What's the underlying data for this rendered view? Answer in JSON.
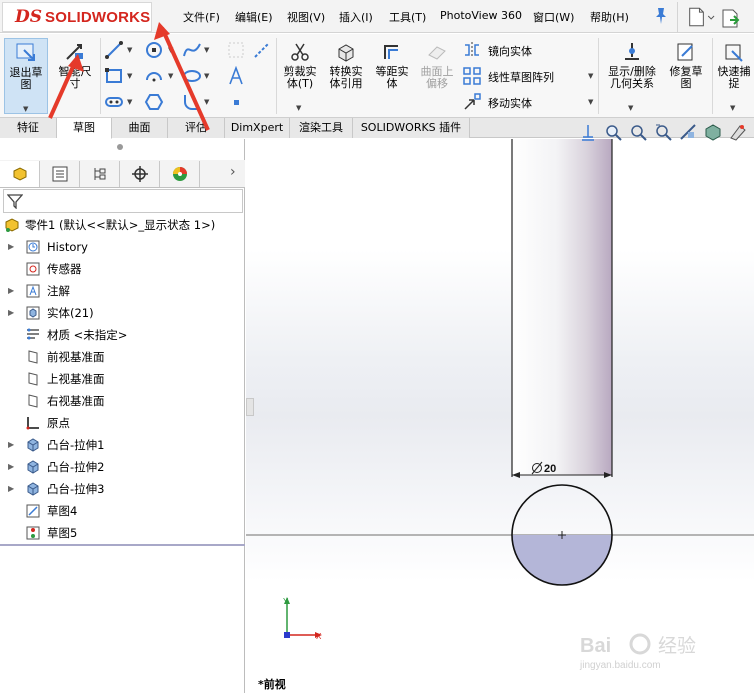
{
  "app": {
    "logo_prefix": "DS",
    "logo_text": "SOLIDWORKS"
  },
  "menubar": {
    "items": [
      {
        "label": "文件(F)"
      },
      {
        "label": "编辑(E)"
      },
      {
        "label": "视图(V)"
      },
      {
        "label": "插入(I)"
      },
      {
        "label": "工具(T)"
      },
      {
        "label": "PhotoView 360"
      },
      {
        "label": "窗口(W)"
      },
      {
        "label": "帮助(H)"
      }
    ]
  },
  "ribbon": {
    "exit_sketch": "退出草\n图",
    "smart_dimension": "智能尺\n寸",
    "trim": "剪裁实\n体(T)",
    "convert": "转换实\n体引用",
    "offset": "等距实\n体",
    "offset_surface": "曲面上\n偏移",
    "mirror": "镜向实体",
    "linear_pattern": "线性草图阵列",
    "move": "移动实体",
    "display_relations": "显示/删除\n几何关系",
    "repair": "修复草\n图",
    "quick_snap": "快速捕\n捉"
  },
  "tabs": [
    {
      "label": "特征"
    },
    {
      "label": "草图"
    },
    {
      "label": "曲面"
    },
    {
      "label": "评估"
    },
    {
      "label": "DimXpert"
    },
    {
      "label": "渲染工具"
    },
    {
      "label": "SOLIDWORKS 插件"
    }
  ],
  "tree": {
    "root": "零件1  (默认<<默认>_显示状态 1>)",
    "items": [
      {
        "label": "History"
      },
      {
        "label": "传感器"
      },
      {
        "label": "注解"
      },
      {
        "label": "实体(21)"
      },
      {
        "label": "材质 <未指定>"
      },
      {
        "label": "前视基准面"
      },
      {
        "label": "上视基准面"
      },
      {
        "label": "右视基准面"
      },
      {
        "label": "原点"
      },
      {
        "label": "凸台-拉伸1"
      },
      {
        "label": "凸台-拉伸2"
      },
      {
        "label": "凸台-拉伸3"
      },
      {
        "label": "草图4"
      },
      {
        "label": "草图5"
      }
    ]
  },
  "viewport": {
    "dimension": "20",
    "view_name": "*前视",
    "axis_x": "X",
    "axis_y": "Y",
    "watermark_brand": "Bai",
    "watermark_cn": "经验",
    "watermark_url": "jingyan.baidu.com"
  },
  "colors": {
    "accent_red": "#e53a2a",
    "sketch_blue": "#b4b6d8",
    "part_purple": "#b8a8c0"
  }
}
